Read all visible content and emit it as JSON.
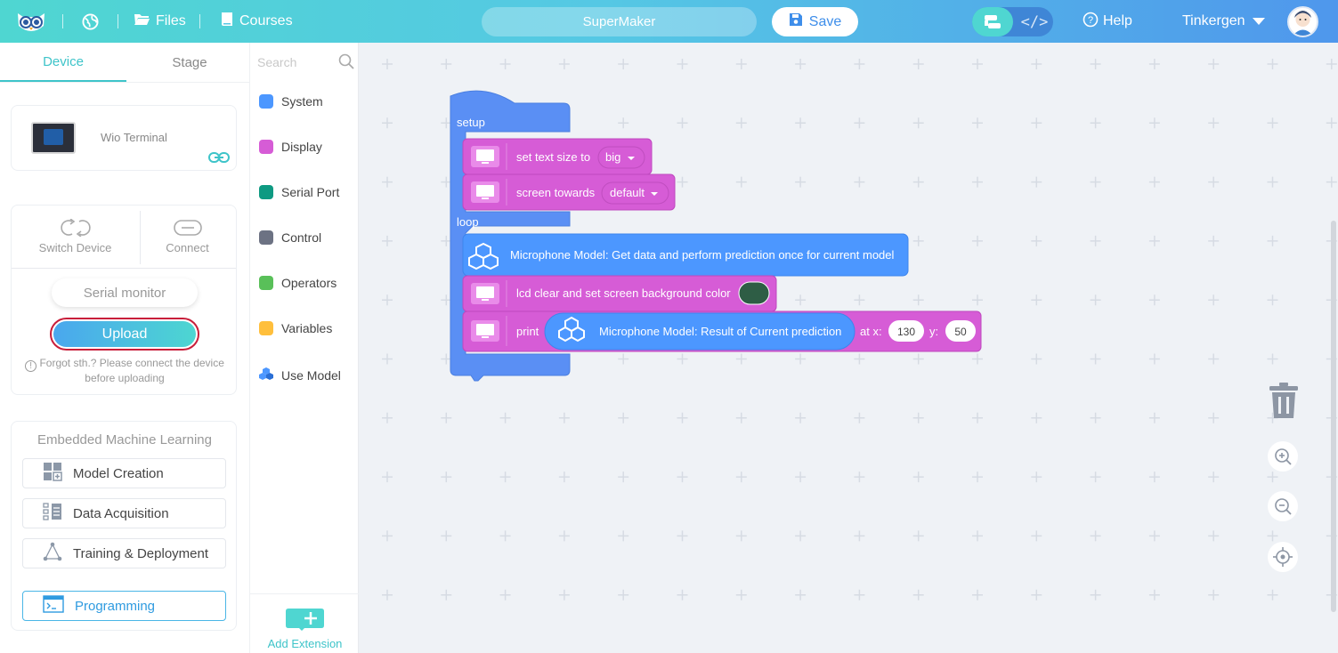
{
  "topbar": {
    "files_label": "Files",
    "courses_label": "Courses",
    "project_name": "SuperMaker",
    "save_label": "Save",
    "help_label": "Help",
    "user_label": "Tinkergen",
    "icons": [
      "owl-logo-icon",
      "globe-icon",
      "folder-icon",
      "book-icon",
      "save-icon",
      "blocks-mode-icon",
      "code-mode-icon",
      "help-icon",
      "chevron-down-icon",
      "avatar-icon"
    ]
  },
  "left": {
    "tabs": [
      "Device",
      "Stage"
    ],
    "device_name": "Wio Terminal",
    "switch_device": "Switch Device",
    "connect": "Connect",
    "serial_monitor": "Serial monitor",
    "upload": "Upload",
    "hint": "Forgot sth.? Please connect the device before uploading",
    "ml_title": "Embedded Machine Learning",
    "ml_items": [
      "Model Creation",
      "Data Acquisition",
      "Training & Deployment"
    ],
    "programming": "Programming"
  },
  "categories": {
    "search_placeholder": "Search",
    "items": [
      {
        "label": "System",
        "color": "#4c97ff"
      },
      {
        "label": "Display",
        "color": "#d65cd6"
      },
      {
        "label": "Serial Port",
        "color": "#0e9a82"
      },
      {
        "label": "Control",
        "color": "#6c7283"
      },
      {
        "label": "Operators",
        "color": "#59c059"
      },
      {
        "label": "Variables",
        "color": "#ffbf3c"
      },
      {
        "label": "Use Model",
        "color": "#4c97ff"
      }
    ],
    "add_extension": "Add Extension"
  },
  "workspace": {
    "setup_label": "setup",
    "loop_label": "loop",
    "block1_text": "set text size to",
    "block1_value": "big",
    "block2_text": "screen towards",
    "block2_value": "default",
    "block3_text": "Microphone Model: Get data and perform prediction once for current model",
    "block4_text": "lcd clear and set screen background color",
    "block4_color": "#2e5d45",
    "block5_print": "print",
    "block5_inner": "Microphone Model: Result of Current prediction",
    "block5_atx": "at x:",
    "block5_x": "130",
    "block5_y_label": "y:",
    "block5_y": "50",
    "colors": {
      "event": "#4c97ff",
      "display": "#d65cd6",
      "model": "#4c97ff"
    }
  }
}
